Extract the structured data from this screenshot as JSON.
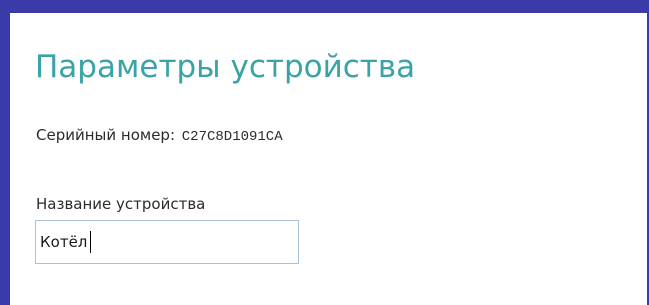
{
  "colors": {
    "frame": "#3a3aa8",
    "title": "#3aa3a6",
    "text": "#2b2b2b",
    "input_border": "#a9c2da"
  },
  "page": {
    "title": "Параметры устройства"
  },
  "serial": {
    "label": "Серийный номер:",
    "value": "C27C8D1091CA"
  },
  "device_name": {
    "label": "Название устройства",
    "value": "Котёл"
  }
}
